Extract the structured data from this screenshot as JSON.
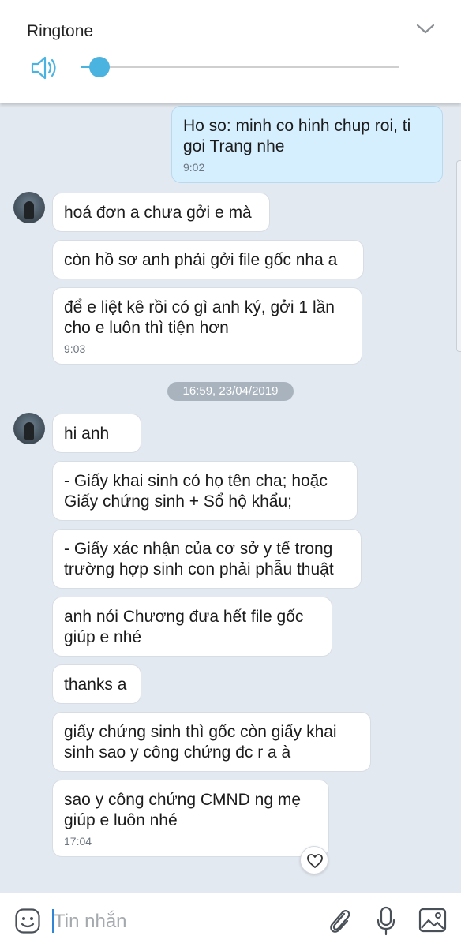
{
  "volume_panel": {
    "title": "Ringtone",
    "level": 0.06,
    "icons": {
      "speaker": "speaker-icon",
      "collapse": "chevron-down-icon"
    },
    "accent_color": "#4bb3e0"
  },
  "messages": [
    {
      "direction": "outgoing",
      "text": "Ho so: minh co hinh chup roi, ti goi Trang nhe",
      "time": "9:02"
    },
    {
      "direction": "incoming",
      "text": "hoá đơn a chưa gởi e mà"
    },
    {
      "direction": "incoming",
      "text": "còn hồ sơ anh phải gởi file gốc nha a"
    },
    {
      "direction": "incoming",
      "text": "để e liệt kê rồi có gì anh ký, gởi 1 lần cho e luôn thì tiện hơn",
      "time": "9:03"
    },
    {
      "direction": "incoming",
      "text": "hi anh"
    },
    {
      "direction": "incoming",
      "text": "- Giấy khai sinh có họ tên cha; hoặc Giấy chứng sinh + Sổ hộ khẩu;"
    },
    {
      "direction": "incoming",
      "text": "- Giấy xác nhận của cơ sở y tế trong trường hợp sinh con phải phẫu thuật"
    },
    {
      "direction": "incoming",
      "text": "anh nói Chương đưa hết file gốc giúp e nhé"
    },
    {
      "direction": "incoming",
      "text": "thanks a"
    },
    {
      "direction": "incoming",
      "text": "giấy chứng sinh thì gốc còn giấy khai sinh sao y công chứng đc r a à"
    },
    {
      "direction": "incoming",
      "text": "sao y công chứng CMND ng mẹ giúp e luôn nhé",
      "time": "17:04"
    }
  ],
  "date_separator": "16:59, 23/04/2019",
  "reaction_icon": "heart-icon",
  "input_bar": {
    "placeholder": "Tin nhắn",
    "icons": [
      "sticker-icon",
      "attachment-icon",
      "microphone-icon",
      "image-icon"
    ]
  },
  "colors": {
    "chat_background": "#e3e9f0",
    "outgoing_bubble": "#d6efff",
    "incoming_bubble": "#ffffff"
  }
}
